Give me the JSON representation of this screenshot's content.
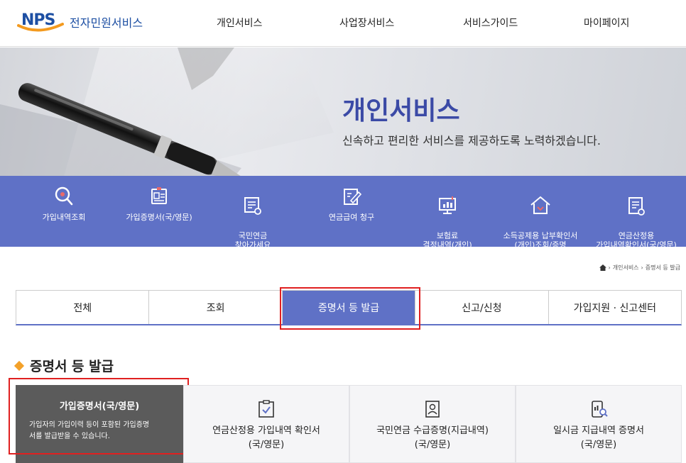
{
  "header": {
    "logo_mark": "NPS",
    "logo_text": "전자민원서비스",
    "nav": [
      "개인서비스",
      "사업장서비스",
      "서비스가이드",
      "마이페이지"
    ]
  },
  "hero": {
    "title": "개인서비스",
    "subtitle": "신속하고 편리한 서비스를 제공하도록 노력하겠습니다."
  },
  "quick_menu": [
    {
      "label": "가입내역조회",
      "icon": "search-icon"
    },
    {
      "label": "가입증명서(국/영문)",
      "icon": "certificate-icon"
    },
    {
      "label": "국민연금\n찾아가세요",
      "icon": "document-search-icon"
    },
    {
      "label": "연금급여 청구",
      "icon": "form-pen-icon"
    },
    {
      "label": "보험료\n결정내역(개인)",
      "icon": "monitor-chart-icon"
    },
    {
      "label": "소득공제용 납부확인서\n(개인)조회/증명",
      "icon": "house-icon"
    },
    {
      "label": "연금산정용\n가입내역확인서(국/영문)",
      "icon": "document-check-icon"
    }
  ],
  "breadcrumb": [
    "개인서비스",
    "증명서 등 발급"
  ],
  "tabs": [
    "전체",
    "조회",
    "증명서 등 발급",
    "신고/신청",
    "가입지원 · 신고센터"
  ],
  "active_tab": "증명서 등 발급",
  "section": {
    "title": "증명서 등 발급"
  },
  "cards": [
    {
      "title": "가입증명서(국/영문)",
      "desc": "가입자의 가입이력 등이 포함된 가입증명서를 발급받을 수 있습니다.",
      "desc_line1": "가입자의 가입이력 등이 포함된 가입증명",
      "desc_line2": "서를 발급받을 수 있습니다."
    },
    {
      "title_line1": "연금산정용 가입내역 확인서",
      "title_line2": "(국/영문)",
      "icon": "checklist-icon"
    },
    {
      "title_line1": "국민연금 수급증명(지급내역)",
      "title_line2": "(국/영문)",
      "icon": "person-card-icon"
    },
    {
      "title_line1": "일시금 지급내역 증명서",
      "title_line2": "(국/영문)",
      "icon": "phone-chart-icon"
    }
  ],
  "colors": {
    "brand_blue": "#1d4fa3",
    "accent": "#5f71c6",
    "highlight": "#e02020",
    "orange": "#f3a12a"
  }
}
